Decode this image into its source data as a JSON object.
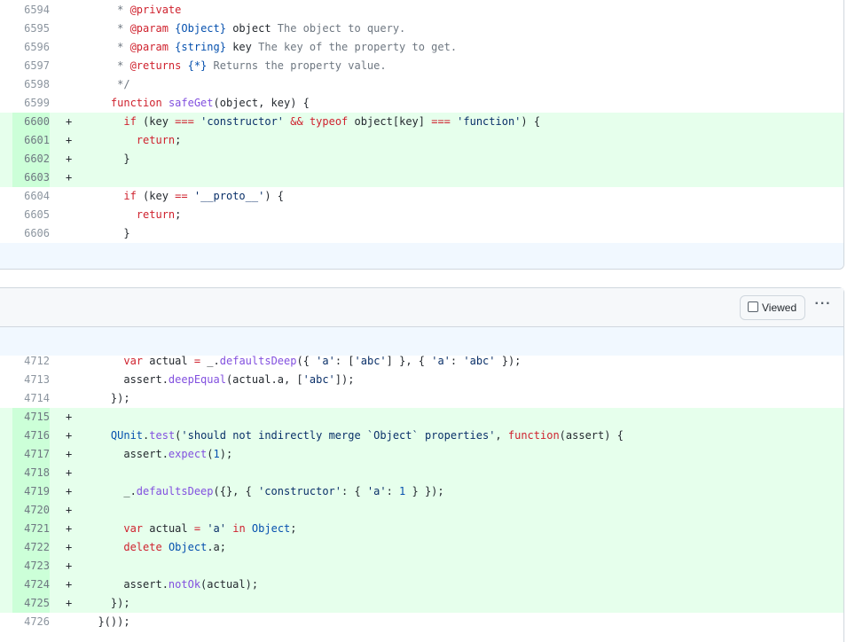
{
  "file1": {
    "lines": [
      {
        "num": "6594",
        "marker": "",
        "type": "ctx",
        "tokens": [
          [
            "cm",
            "     * "
          ],
          [
            "cmk",
            "@private"
          ]
        ]
      },
      {
        "num": "6595",
        "marker": "",
        "type": "ctx",
        "tokens": [
          [
            "cm",
            "     * "
          ],
          [
            "cmk",
            "@param"
          ],
          [
            "cm",
            " "
          ],
          [
            "typ",
            "{Object}"
          ],
          [
            "cm",
            " "
          ],
          [
            "id",
            "object"
          ],
          [
            "cm",
            " The object to query."
          ]
        ]
      },
      {
        "num": "6596",
        "marker": "",
        "type": "ctx",
        "tokens": [
          [
            "cm",
            "     * "
          ],
          [
            "cmk",
            "@param"
          ],
          [
            "cm",
            " "
          ],
          [
            "typ",
            "{string}"
          ],
          [
            "cm",
            " "
          ],
          [
            "id",
            "key"
          ],
          [
            "cm",
            " The key of the property to get."
          ]
        ]
      },
      {
        "num": "6597",
        "marker": "",
        "type": "ctx",
        "tokens": [
          [
            "cm",
            "     * "
          ],
          [
            "cmk",
            "@returns"
          ],
          [
            "cm",
            " "
          ],
          [
            "typ",
            "{*}"
          ],
          [
            "cm",
            " Returns the property value."
          ]
        ]
      },
      {
        "num": "6598",
        "marker": "",
        "type": "ctx",
        "tokens": [
          [
            "cm",
            "     */"
          ]
        ]
      },
      {
        "num": "6599",
        "marker": "",
        "type": "ctx",
        "tokens": [
          [
            "id",
            "    "
          ],
          [
            "kw",
            "function"
          ],
          [
            "id",
            " "
          ],
          [
            "fn",
            "safeGet"
          ],
          [
            "id",
            "(object, key) {"
          ]
        ]
      },
      {
        "num": "6600",
        "marker": "+",
        "type": "add",
        "tokens": [
          [
            "id",
            "      "
          ],
          [
            "kw",
            "if"
          ],
          [
            "id",
            " (key "
          ],
          [
            "kw",
            "==="
          ],
          [
            "id",
            " "
          ],
          [
            "str",
            "'constructor'"
          ],
          [
            "id",
            " "
          ],
          [
            "kw",
            "&&"
          ],
          [
            "id",
            " "
          ],
          [
            "kw",
            "typeof"
          ],
          [
            "id",
            " object[key] "
          ],
          [
            "kw",
            "==="
          ],
          [
            "id",
            " "
          ],
          [
            "str",
            "'function'"
          ],
          [
            "id",
            ") {"
          ]
        ]
      },
      {
        "num": "6601",
        "marker": "+",
        "type": "add",
        "tokens": [
          [
            "id",
            "        "
          ],
          [
            "kw",
            "return"
          ],
          [
            "id",
            ";"
          ]
        ]
      },
      {
        "num": "6602",
        "marker": "+",
        "type": "add",
        "tokens": [
          [
            "id",
            "      }"
          ]
        ]
      },
      {
        "num": "6603",
        "marker": "+",
        "type": "add",
        "tokens": [
          [
            "id",
            ""
          ]
        ]
      },
      {
        "num": "6604",
        "marker": "",
        "type": "ctx",
        "tokens": [
          [
            "id",
            "      "
          ],
          [
            "kw",
            "if"
          ],
          [
            "id",
            " (key "
          ],
          [
            "kw",
            "=="
          ],
          [
            "id",
            " "
          ],
          [
            "str",
            "'__proto__'"
          ],
          [
            "id",
            ") {"
          ]
        ]
      },
      {
        "num": "6605",
        "marker": "",
        "type": "ctx",
        "tokens": [
          [
            "id",
            "        "
          ],
          [
            "kw",
            "return"
          ],
          [
            "id",
            ";"
          ]
        ]
      },
      {
        "num": "6606",
        "marker": "",
        "type": "ctx",
        "tokens": [
          [
            "id",
            "      }"
          ]
        ]
      }
    ]
  },
  "file2": {
    "viewed_label": "Viewed",
    "more_label": "···",
    "lines": [
      {
        "num": "4712",
        "marker": "",
        "type": "ctx",
        "tokens": [
          [
            "id",
            "      "
          ],
          [
            "kw",
            "var"
          ],
          [
            "id",
            " actual "
          ],
          [
            "kw",
            "="
          ],
          [
            "id",
            " _."
          ],
          [
            "fn",
            "defaultsDeep"
          ],
          [
            "id",
            "({ "
          ],
          [
            "str",
            "'a'"
          ],
          [
            "id",
            ": ["
          ],
          [
            "str",
            "'abc'"
          ],
          [
            "id",
            "] }, { "
          ],
          [
            "str",
            "'a'"
          ],
          [
            "id",
            ": "
          ],
          [
            "str",
            "'abc'"
          ],
          [
            "id",
            " });"
          ]
        ]
      },
      {
        "num": "4713",
        "marker": "",
        "type": "ctx",
        "tokens": [
          [
            "id",
            "      assert."
          ],
          [
            "fn",
            "deepEqual"
          ],
          [
            "id",
            "(actual.a, ["
          ],
          [
            "str",
            "'abc'"
          ],
          [
            "id",
            "]);"
          ]
        ]
      },
      {
        "num": "4714",
        "marker": "",
        "type": "ctx",
        "tokens": [
          [
            "id",
            "    });"
          ]
        ]
      },
      {
        "num": "4715",
        "marker": "+",
        "type": "add",
        "tokens": [
          [
            "id",
            ""
          ]
        ]
      },
      {
        "num": "4716",
        "marker": "+",
        "type": "add",
        "tokens": [
          [
            "id",
            "    "
          ],
          [
            "typ",
            "QUnit"
          ],
          [
            "id",
            "."
          ],
          [
            "fn",
            "test"
          ],
          [
            "id",
            "("
          ],
          [
            "str",
            "'should not indirectly merge `Object` properties'"
          ],
          [
            "id",
            ", "
          ],
          [
            "kw",
            "function"
          ],
          [
            "id",
            "(assert) {"
          ]
        ]
      },
      {
        "num": "4717",
        "marker": "+",
        "type": "add",
        "tokens": [
          [
            "id",
            "      assert."
          ],
          [
            "fn",
            "expect"
          ],
          [
            "id",
            "("
          ],
          [
            "num-lit",
            "1"
          ],
          [
            "id",
            ");"
          ]
        ]
      },
      {
        "num": "4718",
        "marker": "+",
        "type": "add",
        "tokens": [
          [
            "id",
            ""
          ]
        ]
      },
      {
        "num": "4719",
        "marker": "+",
        "type": "add",
        "tokens": [
          [
            "id",
            "      _."
          ],
          [
            "fn",
            "defaultsDeep"
          ],
          [
            "id",
            "({}, { "
          ],
          [
            "str",
            "'constructor'"
          ],
          [
            "id",
            ": { "
          ],
          [
            "str",
            "'a'"
          ],
          [
            "id",
            ": "
          ],
          [
            "num-lit",
            "1"
          ],
          [
            "id",
            " } });"
          ]
        ]
      },
      {
        "num": "4720",
        "marker": "+",
        "type": "add",
        "tokens": [
          [
            "id",
            ""
          ]
        ]
      },
      {
        "num": "4721",
        "marker": "+",
        "type": "add",
        "tokens": [
          [
            "id",
            "      "
          ],
          [
            "kw",
            "var"
          ],
          [
            "id",
            " actual "
          ],
          [
            "kw",
            "="
          ],
          [
            "id",
            " "
          ],
          [
            "str",
            "'a'"
          ],
          [
            "id",
            " "
          ],
          [
            "kw",
            "in"
          ],
          [
            "id",
            " "
          ],
          [
            "typ",
            "Object"
          ],
          [
            "id",
            ";"
          ]
        ]
      },
      {
        "num": "4722",
        "marker": "+",
        "type": "add",
        "tokens": [
          [
            "id",
            "      "
          ],
          [
            "kw",
            "delete"
          ],
          [
            "id",
            " "
          ],
          [
            "typ",
            "Object"
          ],
          [
            "id",
            ".a;"
          ]
        ]
      },
      {
        "num": "4723",
        "marker": "+",
        "type": "add",
        "tokens": [
          [
            "id",
            ""
          ]
        ]
      },
      {
        "num": "4724",
        "marker": "+",
        "type": "add",
        "tokens": [
          [
            "id",
            "      assert."
          ],
          [
            "fn",
            "notOk"
          ],
          [
            "id",
            "(actual);"
          ]
        ]
      },
      {
        "num": "4725",
        "marker": "+",
        "type": "add",
        "tokens": [
          [
            "id",
            "    });"
          ]
        ]
      },
      {
        "num": "4726",
        "marker": "",
        "type": "ctx",
        "tokens": [
          [
            "id",
            "  }());"
          ]
        ]
      }
    ]
  }
}
